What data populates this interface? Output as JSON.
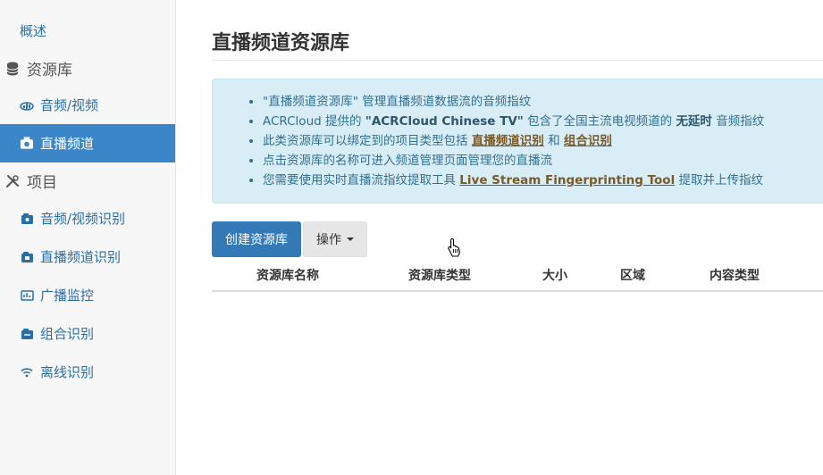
{
  "sidebar": {
    "overview": "概述",
    "library_heading": "资源库",
    "audio_video": "音频/视频",
    "live_channel": "直播频道",
    "project_heading": "项目",
    "av_recognition": "音频/视频识别",
    "live_recognition": "直播频道识别",
    "broadcast_monitor": "广播监控",
    "hybrid_recognition": "组合识别",
    "offline_recognition": "离线识别"
  },
  "page": {
    "title": "直播频道资源库"
  },
  "info": {
    "l1": "\"直播频道资源库\" 管理直播频道数据流的音频指纹",
    "l2_a": "ACRCloud 提供的 ",
    "l2_b": "\"ACRCloud Chinese TV\"",
    "l2_c": " 包含了全国主流电视频道的 ",
    "l2_d": "无延时",
    "l2_e": " 音频指纹",
    "l3_a": "此类资源库可以绑定到的项目类型包括 ",
    "l3_link1": "直播频道识别",
    "l3_b": " 和 ",
    "l3_link2": "组合识别",
    "l4": "点击资源库的名称可进入频道管理页面管理您的直播流",
    "l5_a": "您需要使用实时直播流指纹提取工具 ",
    "l5_link": "Live Stream Fingerprinting Tool",
    "l5_b": " 提取并上传指纹"
  },
  "toolbar": {
    "create_label": "创建资源库",
    "ops_label": "操作"
  },
  "table": {
    "columns": [
      "资源库名称",
      "资源库类型",
      "大小",
      "区域",
      "内容类型"
    ]
  },
  "colors": {
    "accent": "#337ab7",
    "active_nav": "#3a86c8",
    "info_bg": "#d9edf7",
    "info_text": "#31708f"
  }
}
